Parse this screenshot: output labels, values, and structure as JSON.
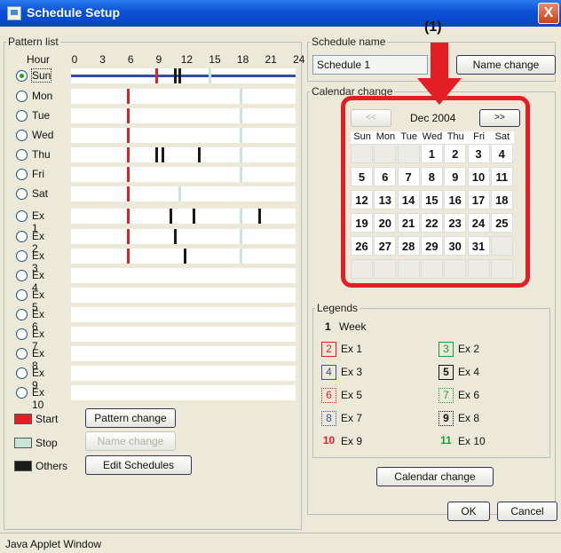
{
  "window": {
    "title": "Schedule Setup",
    "close_label": "X"
  },
  "annotation": {
    "label": "(1)"
  },
  "pattern_list": {
    "legend": "Pattern list",
    "hour_label": "Hour",
    "hour_ticks": [
      "0",
      "3",
      "6",
      "9",
      "12",
      "15",
      "18",
      "21",
      "24"
    ],
    "rows": [
      {
        "label": "Sun",
        "selected": true
      },
      {
        "label": "Mon",
        "selected": false
      },
      {
        "label": "Tue",
        "selected": false
      },
      {
        "label": "Wed",
        "selected": false
      },
      {
        "label": "Thu",
        "selected": false
      },
      {
        "label": "Fri",
        "selected": false
      },
      {
        "label": "Sat",
        "selected": false
      },
      {
        "label": "Ex 1",
        "selected": false
      },
      {
        "label": "Ex 2",
        "selected": false
      },
      {
        "label": "Ex 3",
        "selected": false
      },
      {
        "label": "Ex 4",
        "selected": false
      },
      {
        "label": "Ex 5",
        "selected": false
      },
      {
        "label": "Ex 6",
        "selected": false
      },
      {
        "label": "Ex 7",
        "selected": false
      },
      {
        "label": "Ex 8",
        "selected": false
      },
      {
        "label": "Ex 9",
        "selected": false
      },
      {
        "label": "Ex 10",
        "selected": false
      }
    ],
    "colors": {
      "start": "#e31e24",
      "stop": "#c8e6d8",
      "others": "#1a1a1a",
      "sun_line": "#2f4ea8"
    },
    "legend_items": [
      {
        "label": "Start"
      },
      {
        "label": "Stop"
      },
      {
        "label": "Others"
      }
    ],
    "buttons": {
      "pattern_change": "Pattern change",
      "name_change": "Name change",
      "edit_schedules": "Edit Schedules"
    }
  },
  "schedule_name": {
    "legend": "Schedule name",
    "value": "Schedule 1",
    "name_change_label": "Name change"
  },
  "calendar": {
    "legend": "Calendar change",
    "prev_label": "<<",
    "next_label": ">>",
    "month": "Dec 2004",
    "weekdays": [
      "Sun",
      "Mon",
      "Tue",
      "Wed",
      "Thu",
      "Fri",
      "Sat"
    ],
    "weeks": [
      [
        "",
        "",
        "",
        "1",
        "2",
        "3",
        "4"
      ],
      [
        "5",
        "6",
        "7",
        "8",
        "9",
        "10",
        "11"
      ],
      [
        "12",
        "13",
        "14",
        "15",
        "16",
        "17",
        "18"
      ],
      [
        "19",
        "20",
        "21",
        "22",
        "23",
        "24",
        "25"
      ],
      [
        "26",
        "27",
        "28",
        "29",
        "30",
        "31",
        ""
      ],
      [
        "",
        "",
        "",
        "",
        "",
        "",
        ""
      ]
    ]
  },
  "legends": {
    "legend": "Legends",
    "week": {
      "num": "1",
      "label": "Week"
    },
    "items": [
      {
        "num": "2",
        "label": "Ex 1",
        "color": "#e31e24",
        "style": "solid"
      },
      {
        "num": "3",
        "label": "Ex 2",
        "color": "#1f9a3a",
        "style": "solid"
      },
      {
        "num": "4",
        "label": "Ex 3",
        "color": "#3a4fa0",
        "style": "solid"
      },
      {
        "num": "5",
        "label": "Ex 4",
        "color": "#111111",
        "style": "solid"
      },
      {
        "num": "6",
        "label": "Ex 5",
        "color": "#e31e24",
        "style": "dotted"
      },
      {
        "num": "7",
        "label": "Ex 6",
        "color": "#1f9a3a",
        "style": "dotted"
      },
      {
        "num": "8",
        "label": "Ex 7",
        "color": "#3a4fa0",
        "style": "dotted"
      },
      {
        "num": "9",
        "label": "Ex 8",
        "color": "#111111",
        "style": "dotted"
      },
      {
        "num": "10",
        "label": "Ex 9",
        "color": "#e31e24",
        "style": "none"
      },
      {
        "num": "11",
        "label": "Ex 10",
        "color": "#1f9a3a",
        "style": "none"
      }
    ],
    "calendar_change_label": "Calendar change"
  },
  "footer": {
    "ok_label": "OK",
    "cancel_label": "Cancel"
  },
  "status": {
    "text": "Java Applet Window"
  }
}
